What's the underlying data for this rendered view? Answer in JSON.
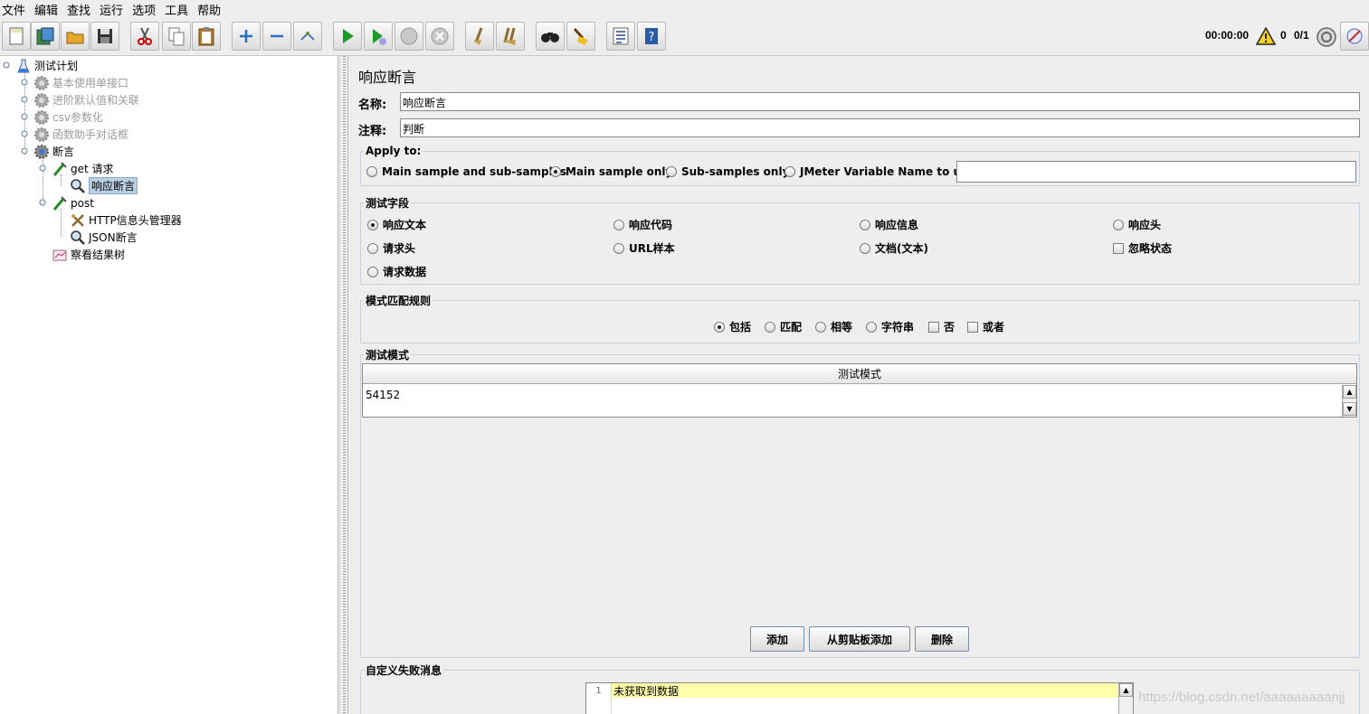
{
  "menubar": [
    "文件",
    "编辑",
    "查找",
    "运行",
    "选项",
    "工具",
    "帮助"
  ],
  "toolbar": {
    "buttons": [
      "new-icon",
      "templates-icon",
      "open-icon",
      "save-icon",
      "cut-icon",
      "copy-icon",
      "paste-icon",
      "expand-icon",
      "collapse-icon",
      "toggle-icon",
      "start-icon",
      "start-no-pauses-icon",
      "stop-icon",
      "shutdown-icon",
      "clear-icon",
      "clear-all-icon",
      "search-icon",
      "reset-search-icon",
      "function-helper-icon",
      "help-icon"
    ],
    "timer": "00:00:00",
    "warnings": "0",
    "threads": "0/1"
  },
  "tree": {
    "nodes": [
      {
        "label": "测试计划",
        "icon": "test-plan-icon"
      },
      {
        "label": "基本使用单接口",
        "icon": "thread-group-icon",
        "disabled": true
      },
      {
        "label": "进阶默认值和关联",
        "icon": "thread-group-icon",
        "disabled": true
      },
      {
        "label": "csv参数化",
        "icon": "thread-group-icon",
        "disabled": true
      },
      {
        "label": "函数助手对话框",
        "icon": "thread-group-icon",
        "disabled": true
      },
      {
        "label": "断言",
        "icon": "thread-group-icon"
      },
      {
        "label": "get 请求",
        "icon": "sampler-icon"
      },
      {
        "label": "响应断言",
        "icon": "assertion-icon",
        "selected": true
      },
      {
        "label": "post",
        "icon": "sampler-icon"
      },
      {
        "label": "HTTP信息头管理器",
        "icon": "config-icon"
      },
      {
        "label": "JSON断言",
        "icon": "assertion-icon"
      },
      {
        "label": "察看结果树",
        "icon": "listener-icon"
      }
    ]
  },
  "panel": {
    "title": "响应断言",
    "name_label": "名称:",
    "name_value": "响应断言",
    "comment_label": "注释:",
    "comment_value": "判断"
  },
  "apply_to": {
    "legend": "Apply to:",
    "options": [
      "Main sample and sub-samples",
      "Main sample only",
      "Sub-samples only",
      "JMeter Variable Name to use"
    ],
    "selected": 1,
    "variable_value": ""
  },
  "test_field": {
    "legend": "测试字段",
    "options": [
      "响应文本",
      "响应代码",
      "响应信息",
      "响应头",
      "请求头",
      "URL样本",
      "文档(文本)",
      "请求数据"
    ],
    "selected": 0,
    "checkbox": "忽略状态"
  },
  "pattern_rules": {
    "legend": "模式匹配规则",
    "options": [
      "包括",
      "匹配",
      "相等",
      "字符串"
    ],
    "selected": 0,
    "checkboxes": [
      "否",
      "或者"
    ]
  },
  "patterns": {
    "legend": "测试模式",
    "column_header": "测试模式",
    "rows": [
      "54152"
    ],
    "buttons": [
      "添加",
      "从剪贴板添加",
      "删除"
    ]
  },
  "custom_failure": {
    "legend": "自定义失败消息",
    "line_number": "1",
    "text": "未获取到数据"
  },
  "watermark": "https://blog.csdn.net/aaaaaaaaanjj"
}
